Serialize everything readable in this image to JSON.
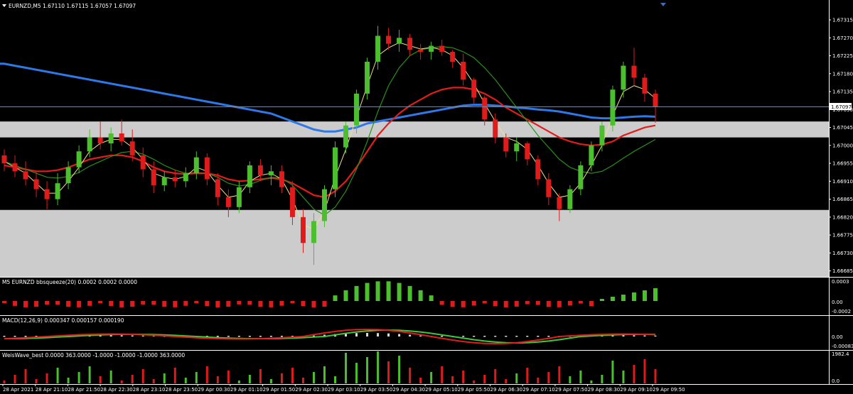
{
  "colors": {
    "background": "#000000",
    "grid_frame": "#ffffff",
    "bull_candle": "#4bbf2e",
    "bear_candle": "#e01b1b",
    "ma_blue": "#2f78e8",
    "ma_red": "#e31d1d",
    "ma_green": "#2a8f1a",
    "ma_yellow": "#f0e08a",
    "zone": "#cccccc",
    "price_line": "#7f8fa6",
    "macd_main": "#e31d1d",
    "macd_signal": "#3cc83c",
    "histogram_white": "#dddddd"
  },
  "main": {
    "header": "EURNZD,M5  1.67110 1.67115 1.67057 1.67097",
    "current_price_label": "1.67097",
    "y_ticks": [
      "1.67315",
      "1.67270",
      "1.67225",
      "1.67180",
      "1.67135",
      "1.67090",
      "1.67045",
      "1.67000",
      "1.66955",
      "1.66910",
      "1.66865",
      "1.66820",
      "1.66775",
      "1.66730",
      "1.66685"
    ]
  },
  "panel1": {
    "title": "M5 EURNZD bbsqueeze(20) 0.0002 0.0002 0.0000",
    "y_ticks": [
      "0.0003",
      "0.00",
      "-0.0002"
    ]
  },
  "panel2": {
    "title": "MACD(12,26,9) 0.000347 0.000157 0.000190",
    "y_ticks": [
      "0.00",
      "-0.00083"
    ]
  },
  "panel3": {
    "title": "WeisWave_best 0.0000 363.0000 -1.0000 -1.0000 -1.0000 363.0000",
    "y_ticks": [
      "1982.4",
      "0.0"
    ]
  },
  "x_labels": [
    "28 Apr 2021",
    "28 Apr 21:10",
    "28 Apr 21:50",
    "28 Apr 22:30",
    "28 Apr 23:10",
    "28 Apr 23:50",
    "29 Apr 00:30",
    "29 Apr 01:10",
    "29 Apr 01:50",
    "29 Apr 02:30",
    "29 Apr 03:10",
    "29 Apr 03:50",
    "29 Apr 04:30",
    "29 Apr 05:10",
    "29 Apr 05:50",
    "29 Apr 06:30",
    "29 Apr 07:10",
    "29 Apr 07:50",
    "29 Apr 08:30",
    "29 Apr 09:10",
    "29 Apr 09:50"
  ],
  "chart_data": {
    "type": "candlestick",
    "symbol": "EURNZD",
    "timeframe": "M5",
    "ylim": [
      1.6667,
      1.6734
    ],
    "candles": [
      [
        1.66975,
        1.6699,
        1.66935,
        1.66955
      ],
      [
        1.66955,
        1.66975,
        1.6692,
        1.66935
      ],
      [
        1.66935,
        1.6696,
        1.669,
        1.66915
      ],
      [
        1.66915,
        1.66935,
        1.6687,
        1.6689
      ],
      [
        1.6689,
        1.6691,
        1.6684,
        1.66865
      ],
      [
        1.66865,
        1.6693,
        1.6685,
        1.66905
      ],
      [
        1.66905,
        1.6696,
        1.6689,
        1.66945
      ],
      [
        1.66945,
        1.67,
        1.6693,
        1.66985
      ],
      [
        1.66985,
        1.6704,
        1.6697,
        1.6702
      ],
      [
        1.6702,
        1.6706,
        1.6699,
        1.67005
      ],
      [
        1.67005,
        1.67045,
        1.66985,
        1.6703
      ],
      [
        1.6703,
        1.67065,
        1.67,
        1.6701
      ],
      [
        1.6701,
        1.6704,
        1.6696,
        1.66975
      ],
      [
        1.66975,
        1.66995,
        1.6692,
        1.6694
      ],
      [
        1.6694,
        1.6696,
        1.6688,
        1.669
      ],
      [
        1.669,
        1.66935,
        1.66885,
        1.6692
      ],
      [
        1.6692,
        1.6694,
        1.66895,
        1.6691
      ],
      [
        1.6691,
        1.66945,
        1.66895,
        1.6693
      ],
      [
        1.6693,
        1.66985,
        1.66915,
        1.6697
      ],
      [
        1.6697,
        1.6698,
        1.669,
        1.66915
      ],
      [
        1.66915,
        1.6693,
        1.6685,
        1.6687
      ],
      [
        1.6687,
        1.6689,
        1.6682,
        1.66845
      ],
      [
        1.66845,
        1.6691,
        1.6683,
        1.66895
      ],
      [
        1.66895,
        1.6696,
        1.6688,
        1.6695
      ],
      [
        1.6695,
        1.66965,
        1.6691,
        1.66925
      ],
      [
        1.66925,
        1.6695,
        1.669,
        1.66935
      ],
      [
        1.66935,
        1.6695,
        1.6688,
        1.66895
      ],
      [
        1.66895,
        1.6691,
        1.668,
        1.6682
      ],
      [
        1.6682,
        1.6684,
        1.6673,
        1.66755
      ],
      [
        1.66755,
        1.6683,
        1.667,
        1.6681
      ],
      [
        1.6681,
        1.669,
        1.66795,
        1.6689
      ],
      [
        1.6689,
        1.6701,
        1.6687,
        1.66995
      ],
      [
        1.66995,
        1.6706,
        1.6698,
        1.6705
      ],
      [
        1.6705,
        1.6714,
        1.6703,
        1.6713
      ],
      [
        1.6713,
        1.6722,
        1.67115,
        1.6721
      ],
      [
        1.6721,
        1.673,
        1.6719,
        1.67275
      ],
      [
        1.67275,
        1.67295,
        1.6724,
        1.67255
      ],
      [
        1.67255,
        1.6729,
        1.67235,
        1.6727
      ],
      [
        1.6727,
        1.6728,
        1.67225,
        1.6724
      ],
      [
        1.6724,
        1.67255,
        1.67215,
        1.67235
      ],
      [
        1.67235,
        1.6726,
        1.67215,
        1.6725
      ],
      [
        1.6725,
        1.67265,
        1.67225,
        1.67235
      ],
      [
        1.67235,
        1.6724,
        1.67195,
        1.6721
      ],
      [
        1.6721,
        1.6723,
        1.6715,
        1.67165
      ],
      [
        1.67165,
        1.6717,
        1.67105,
        1.6712
      ],
      [
        1.6712,
        1.67125,
        1.6705,
        1.67065
      ],
      [
        1.67065,
        1.6708,
        1.67005,
        1.6702
      ],
      [
        1.6702,
        1.6703,
        1.6697,
        1.66985
      ],
      [
        1.66985,
        1.6702,
        1.6696,
        1.67005
      ],
      [
        1.67005,
        1.6701,
        1.6695,
        1.66965
      ],
      [
        1.66965,
        1.66975,
        1.669,
        1.66915
      ],
      [
        1.66915,
        1.6693,
        1.6685,
        1.6687
      ],
      [
        1.6687,
        1.6688,
        1.6681,
        1.6684
      ],
      [
        1.6684,
        1.669,
        1.6683,
        1.6689
      ],
      [
        1.6689,
        1.6696,
        1.66875,
        1.6695
      ],
      [
        1.6695,
        1.6701,
        1.66935,
        1.67
      ],
      [
        1.67,
        1.6706,
        1.66985,
        1.6705
      ],
      [
        1.6705,
        1.6715,
        1.67035,
        1.6714
      ],
      [
        1.6714,
        1.6721,
        1.6712,
        1.672
      ],
      [
        1.672,
        1.67245,
        1.6715,
        1.6717
      ],
      [
        1.6717,
        1.6718,
        1.6711,
        1.6713
      ],
      [
        1.6713,
        1.6714,
        1.67057,
        1.67097
      ]
    ],
    "moving_averages": [
      {
        "color": "blue",
        "values": [
          1.67205,
          1.672,
          1.67195,
          1.6719,
          1.67185,
          1.6718,
          1.67175,
          1.6717,
          1.67165,
          1.6716,
          1.67155,
          1.6715,
          1.67145,
          1.6714,
          1.67135,
          1.6713,
          1.67125,
          1.6712,
          1.67115,
          1.6711,
          1.67105,
          1.671,
          1.67095,
          1.6709,
          1.67085,
          1.6708,
          1.6707,
          1.6706,
          1.6705,
          1.6704,
          1.67035,
          1.67035,
          1.6704,
          1.67045,
          1.67055,
          1.6706,
          1.67065,
          1.6707,
          1.67075,
          1.6708,
          1.67085,
          1.6709,
          1.67095,
          1.671,
          1.67102,
          1.67102,
          1.671,
          1.67098,
          1.67095,
          1.67093,
          1.6709,
          1.67088,
          1.67085,
          1.6708,
          1.67075,
          1.6707,
          1.67068,
          1.67068,
          1.6707,
          1.67072,
          1.67073,
          1.67072
        ]
      },
      {
        "color": "red",
        "values": [
          1.6695,
          1.66945,
          1.6694,
          1.66935,
          1.66935,
          1.66938,
          1.66945,
          1.66955,
          1.66965,
          1.6697,
          1.66975,
          1.66975,
          1.6697,
          1.6696,
          1.66945,
          1.66935,
          1.6693,
          1.66928,
          1.6693,
          1.6693,
          1.66925,
          1.66915,
          1.6691,
          1.66912,
          1.66915,
          1.66918,
          1.66915,
          1.66905,
          1.6689,
          1.66875,
          1.6687,
          1.66885,
          1.6691,
          1.66945,
          1.66985,
          1.67025,
          1.67055,
          1.6708,
          1.671,
          1.67115,
          1.6713,
          1.6714,
          1.67145,
          1.67145,
          1.6714,
          1.6713,
          1.67115,
          1.67095,
          1.6708,
          1.67065,
          1.6705,
          1.67035,
          1.6702,
          1.6701,
          1.67003,
          1.67,
          1.67002,
          1.6701,
          1.67025,
          1.67035,
          1.67045,
          1.6705
        ]
      },
      {
        "color": "green",
        "values": [
          1.6696,
          1.6695,
          1.6694,
          1.6693,
          1.6692,
          1.66918,
          1.66922,
          1.66932,
          1.66948,
          1.6696,
          1.66972,
          1.66982,
          1.66985,
          1.66978,
          1.66965,
          1.6695,
          1.66938,
          1.6693,
          1.66932,
          1.6693,
          1.6692,
          1.66905,
          1.66898,
          1.66902,
          1.66912,
          1.6692,
          1.66918,
          1.669,
          1.6687,
          1.6684,
          1.66825,
          1.66845,
          1.66885,
          1.6694,
          1.6701,
          1.67085,
          1.6715,
          1.67195,
          1.67225,
          1.6724,
          1.67245,
          1.67248,
          1.67245,
          1.67235,
          1.6722,
          1.67195,
          1.67165,
          1.6713,
          1.67095,
          1.6706,
          1.67025,
          1.66995,
          1.66965,
          1.66945,
          1.66935,
          1.6693,
          1.66935,
          1.6695,
          1.66968,
          1.66985,
          1.67,
          1.67015
        ]
      },
      {
        "color": "yellow",
        "values": [
          1.6696,
          1.66945,
          1.6693,
          1.66905,
          1.6688,
          1.6688,
          1.6691,
          1.66945,
          1.66985,
          1.67005,
          1.67015,
          1.67015,
          1.66995,
          1.66965,
          1.6693,
          1.6692,
          1.66915,
          1.66922,
          1.66945,
          1.66935,
          1.669,
          1.6687,
          1.66875,
          1.6691,
          1.66925,
          1.6693,
          1.66915,
          1.66865,
          1.668,
          1.6679,
          1.66835,
          1.6692,
          1.6699,
          1.6707,
          1.6715,
          1.67225,
          1.67245,
          1.67258,
          1.6725,
          1.67242,
          1.67246,
          1.6724,
          1.67225,
          1.67195,
          1.67155,
          1.67105,
          1.6706,
          1.6702,
          1.6701,
          1.6699,
          1.6695,
          1.66905,
          1.6687,
          1.66875,
          1.66905,
          1.6695,
          1.67,
          1.67075,
          1.67135,
          1.6715,
          1.6714,
          1.67118
        ]
      }
    ],
    "zones": [
      [
        1.6702,
        1.6706
      ],
      [
        1.6667,
        1.66838
      ]
    ],
    "current_price": 1.67097
  }
}
